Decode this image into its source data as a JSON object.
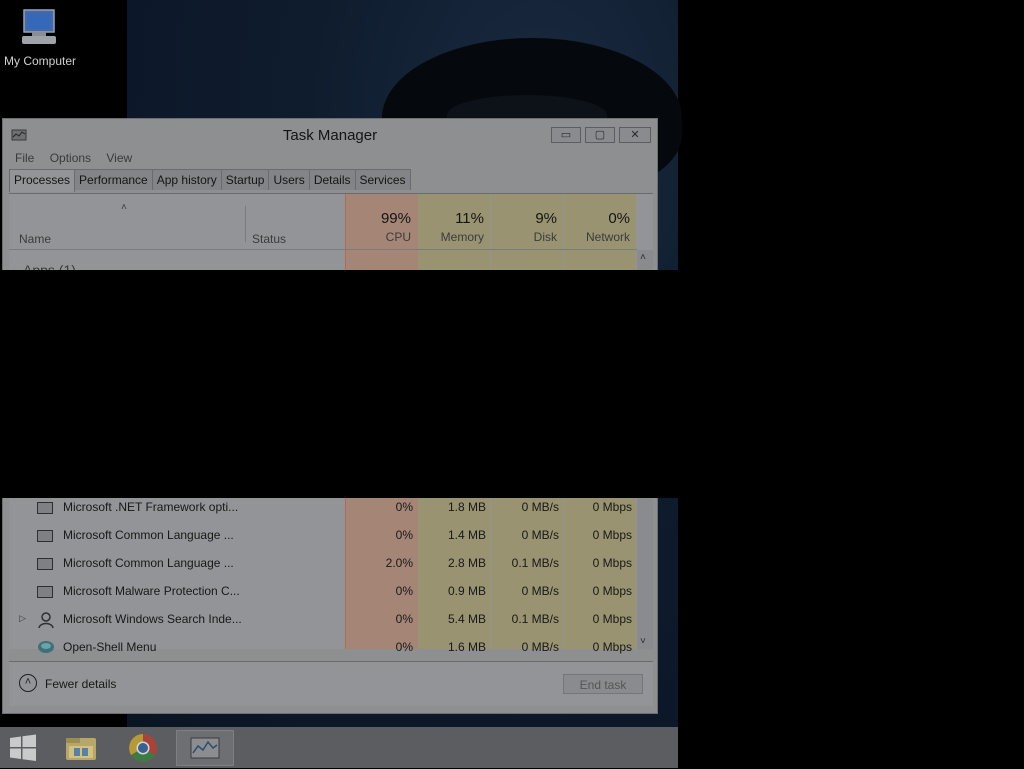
{
  "desktop": {
    "icon_label": "My Computer"
  },
  "window": {
    "title": "Task Manager",
    "controls": {
      "minimize": "▭",
      "maximize": "▢",
      "close": "✕"
    },
    "menu": [
      "File",
      "Options",
      "View"
    ],
    "tabs": [
      "Processes",
      "Performance",
      "App history",
      "Startup",
      "Users",
      "Details",
      "Services"
    ],
    "columns": {
      "name": "Name",
      "status": "Status",
      "cpu": {
        "pct": "99%",
        "label": "CPU"
      },
      "memory": {
        "pct": "11%",
        "label": "Memory"
      },
      "disk": {
        "pct": "9%",
        "label": "Disk"
      },
      "network": {
        "pct": "0%",
        "label": "Network"
      }
    },
    "group_label": "Apps (1)",
    "rows": [
      {
        "name": "Microsoft .NET Framework opti...",
        "cpu": "0%",
        "memory": "1.8 MB",
        "disk": "0 MB/s",
        "network": "0 Mbps"
      },
      {
        "name": "Microsoft Common Language ...",
        "cpu": "0%",
        "memory": "1.4 MB",
        "disk": "0 MB/s",
        "network": "0 Mbps"
      },
      {
        "name": "Microsoft Common Language ...",
        "cpu": "2.0%",
        "memory": "2.8 MB",
        "disk": "0.1 MB/s",
        "network": "0 Mbps"
      },
      {
        "name": "Microsoft Malware Protection C...",
        "cpu": "0%",
        "memory": "0.9 MB",
        "disk": "0 MB/s",
        "network": "0 Mbps"
      },
      {
        "name": "Microsoft Windows Search Inde...",
        "cpu": "0%",
        "memory": "5.4 MB",
        "disk": "0.1 MB/s",
        "network": "0 Mbps"
      },
      {
        "name": "Open-Shell Menu",
        "cpu": "0%",
        "memory": "1.6 MB",
        "disk": "0 MB/s",
        "network": "0 Mbps"
      }
    ],
    "fewer_details": "Fewer details",
    "end_task": "End task"
  },
  "colors": {
    "cpu_highlight": "#a87f6d",
    "column_highlight": "#9a9370"
  }
}
